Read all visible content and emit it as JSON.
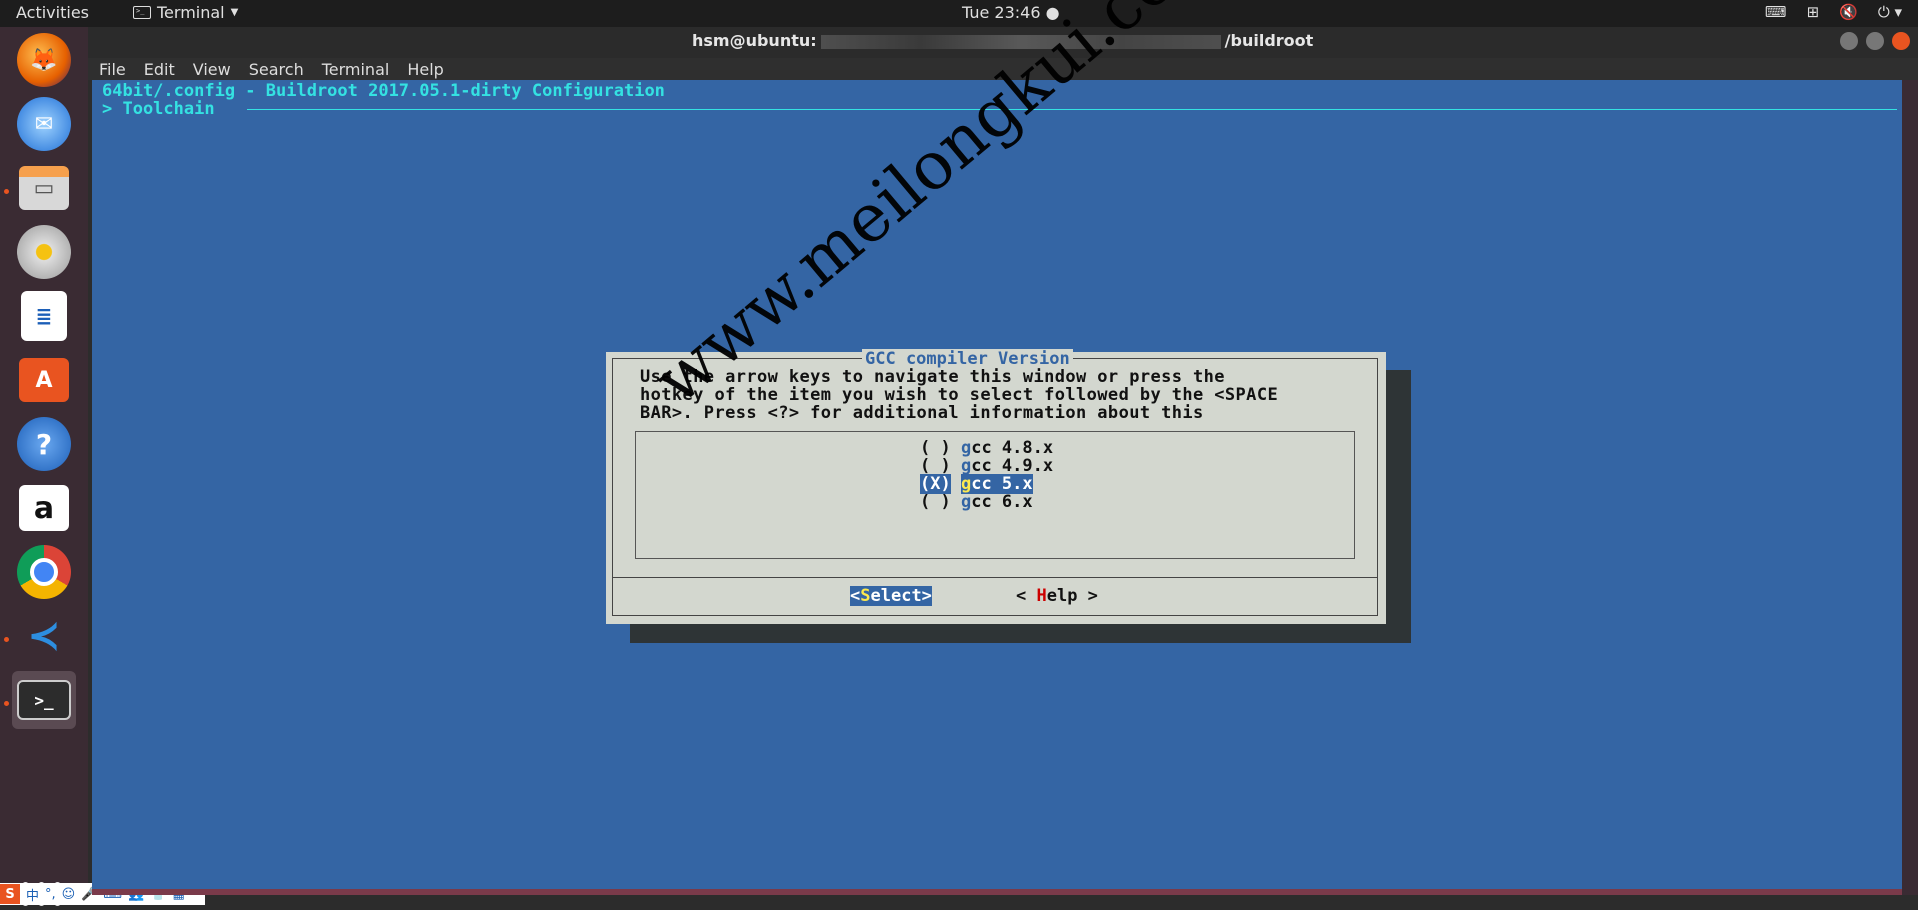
{
  "topbar": {
    "activities": "Activities",
    "app_name": "Terminal",
    "clock": "Tue 23:46 ●"
  },
  "window": {
    "title_prefix": "hsm@ubuntu:",
    "title_suffix": "/buildroot"
  },
  "menu": [
    "File",
    "Edit",
    "View",
    "Search",
    "Terminal",
    "Help"
  ],
  "terminal": {
    "header": "64bit/.config - Buildroot 2017.05.1-dirty Configuration",
    "breadcrumb": "> Toolchain"
  },
  "dialog": {
    "title": "GCC compiler Version",
    "help_line1": "Use the arrow keys to navigate this window or press the",
    "help_line2": "hotkey of the item you wish to select followed by the <SPACE",
    "help_line3": "BAR>. Press <?> for additional information about this",
    "options": [
      {
        "mark": "( )",
        "hotkey": "g",
        "rest": "cc 4.8.x",
        "selected": false
      },
      {
        "mark": "( )",
        "hotkey": "g",
        "rest": "cc 4.9.x",
        "selected": false
      },
      {
        "mark": "(X)",
        "hotkey": "g",
        "rest": "cc 5.x",
        "selected": true
      },
      {
        "mark": "( )",
        "hotkey": "g",
        "rest": "cc 6.x",
        "selected": false
      }
    ],
    "select_button": {
      "open": "<",
      "hotkey": "S",
      "rest": "elect>"
    },
    "help_button": {
      "open": "< ",
      "hotkey": "H",
      "rest": "elp >"
    }
  },
  "watermark": "www.meilongkui.com",
  "dock_icons": [
    "firefox-icon",
    "thunderbird-icon",
    "files-icon",
    "rhythmbox-icon",
    "writer-icon",
    "software-icon",
    "help-icon",
    "amazon-icon",
    "chrome-icon",
    "vscode-icon",
    "terminal-icon"
  ],
  "ime_bar": {
    "logo": "S",
    "lang": "中"
  }
}
